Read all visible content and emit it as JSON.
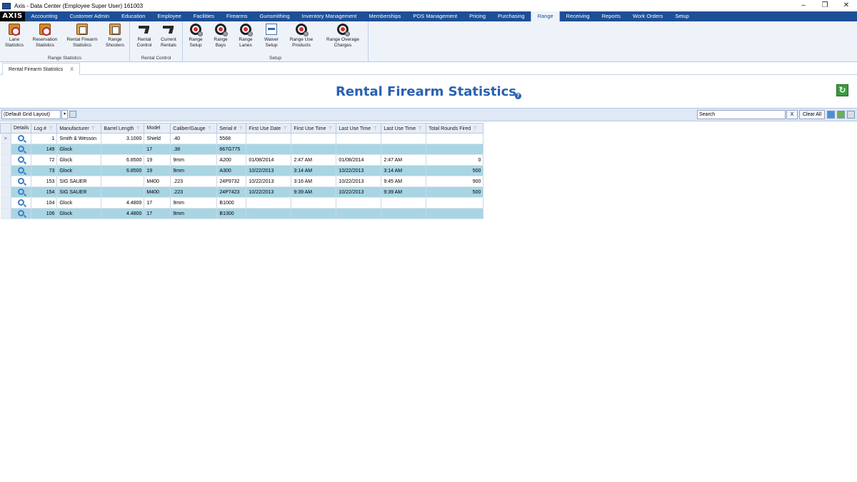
{
  "window": {
    "title": "Axis - Data Center  (Employee Super User) 161003",
    "controls": [
      "–",
      "❐",
      "✕"
    ]
  },
  "menu": {
    "logo": "AXIS",
    "items": [
      "Accounting",
      "Customer Admin",
      "Education",
      "Employee",
      "Facilities",
      "Firearms",
      "Gunsmithing",
      "Inventory Management",
      "Memberships",
      "POS Management",
      "Pricing",
      "Purchasing",
      "Range",
      "Receiving",
      "Reports",
      "Work Orders",
      "Setup"
    ],
    "active": "Range"
  },
  "ribbon": {
    "groups": [
      {
        "label": "Range Statistics",
        "buttons": [
          {
            "line1": "Lane",
            "line2": "Statistics",
            "icon": "clipboard-target-icon"
          },
          {
            "line1": "Reservation",
            "line2": "Statistics",
            "icon": "clipboard-target-icon"
          },
          {
            "line1": "Rental Firearm",
            "line2": "Statistics",
            "icon": "clipboard-icon"
          },
          {
            "line1": "Range",
            "line2": "Shooters",
            "icon": "clipboard-icon"
          }
        ]
      },
      {
        "label": "Rental Control",
        "buttons": [
          {
            "line1": "Rental",
            "line2": "Control",
            "icon": "pistol-icon"
          },
          {
            "line1": "Current",
            "line2": "Rentals",
            "icon": "pistol-icon"
          }
        ]
      },
      {
        "label": "Setup",
        "buttons": [
          {
            "line1": "Range",
            "line2": "Setup",
            "icon": "target-gear-icon"
          },
          {
            "line1": "Range",
            "line2": "Bays",
            "icon": "target-gear-icon"
          },
          {
            "line1": "Range",
            "line2": "Lanes",
            "icon": "target-gear-icon"
          },
          {
            "line1": "Waiver",
            "line2": "Setup",
            "icon": "document-icon"
          },
          {
            "line1": "Range Use",
            "line2": "Products",
            "icon": "target-gear-icon"
          },
          {
            "line1": "Range Overage",
            "line2": "Charges",
            "icon": "target-gear-icon"
          }
        ]
      }
    ]
  },
  "doc_tab": {
    "label": "Rental Firearm Statistics",
    "close": "X"
  },
  "page": {
    "title": "Rental Firearm Statistics",
    "help": "?",
    "refresh": "↻"
  },
  "toolbar": {
    "layout_value": "(Default Grid Layout)",
    "dropdown": "▾",
    "search_value": "Search",
    "clear_x": "X",
    "clear_all": "Clear All"
  },
  "grid": {
    "columns": [
      "Details",
      "Log #",
      "Manufacturer",
      "Barrel Length",
      "Model",
      "Caliber/Gauge",
      "Serial #",
      "First Use Date",
      "First Use Time",
      "Last Use Time",
      "Last Use Time",
      "Total Rounds Fired"
    ],
    "rows": [
      {
        "selected": true,
        "log": "1",
        "manufacturer": "Smith & Wesson",
        "barrel": "3.1000",
        "model": "Shield",
        "caliber": ".40",
        "serial": "5568",
        "first_date": "",
        "first_time": "",
        "last_date": "",
        "last_time": "",
        "rounds": ""
      },
      {
        "selected": false,
        "log": "149",
        "manufacturer": "Glock",
        "barrel": "",
        "model": "17",
        "caliber": ".38",
        "serial": "667G775",
        "first_date": "",
        "first_time": "",
        "last_date": "",
        "last_time": "",
        "rounds": ""
      },
      {
        "selected": false,
        "log": "72",
        "manufacturer": "Glock",
        "barrel": "6.8500",
        "model": "19",
        "caliber": "9mm",
        "serial": "A200",
        "first_date": "01/08/2014",
        "first_time": "2:47 AM",
        "last_date": "01/08/2014",
        "last_time": "2:47 AM",
        "rounds": "0"
      },
      {
        "selected": false,
        "log": "73",
        "manufacturer": "Glock",
        "barrel": "6.8500",
        "model": "19",
        "caliber": "9mm",
        "serial": "A300",
        "first_date": "10/22/2013",
        "first_time": "3:14 AM",
        "last_date": "10/22/2013",
        "last_time": "3:14 AM",
        "rounds": "500"
      },
      {
        "selected": false,
        "log": "153",
        "manufacturer": "SIG SAUER",
        "barrel": "",
        "model": "M400",
        "caliber": ".223",
        "serial": "24P9732",
        "first_date": "10/22/2013",
        "first_time": "3:16 AM",
        "last_date": "10/22/2013",
        "last_time": "9:45 AM",
        "rounds": "900"
      },
      {
        "selected": false,
        "log": "154",
        "manufacturer": "SIG SAUER",
        "barrel": "",
        "model": "M400",
        "caliber": ".223",
        "serial": "24P7423",
        "first_date": "10/22/2013",
        "first_time": "9:39 AM",
        "last_date": "10/22/2013",
        "last_time": "9:39 AM",
        "rounds": "500"
      },
      {
        "selected": false,
        "log": "104",
        "manufacturer": "Glock",
        "barrel": "4.4800",
        "model": "17",
        "caliber": "9mm",
        "serial": "B1000",
        "first_date": "",
        "first_time": "",
        "last_date": "",
        "last_time": "",
        "rounds": ""
      },
      {
        "selected": false,
        "log": "106",
        "manufacturer": "Glock",
        "barrel": "4.4800",
        "model": "17",
        "caliber": "9mm",
        "serial": "B1300",
        "first_date": "",
        "first_time": "",
        "last_date": "",
        "last_time": "",
        "rounds": ""
      }
    ]
  },
  "colors": {
    "menu_bar": "#1d4f97",
    "title": "#2a62b0",
    "alt_row": "#a9d5e3",
    "refresh": "#3c9a3e"
  }
}
